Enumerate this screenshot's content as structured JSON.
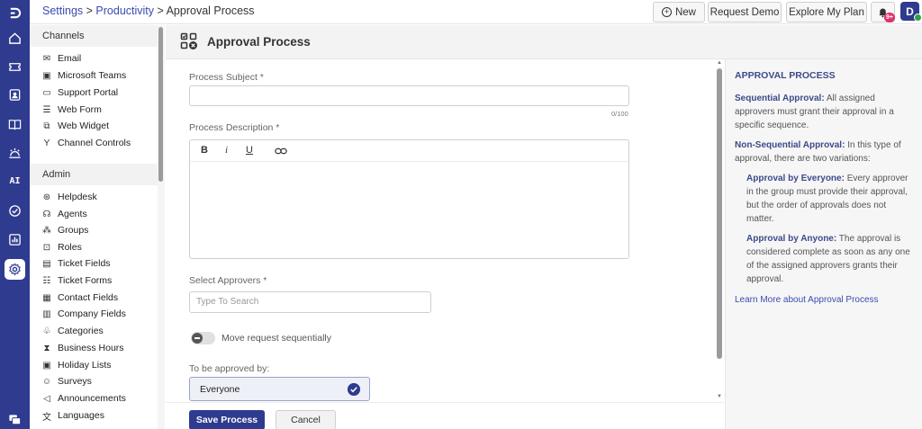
{
  "breadcrumb": {
    "settings": "Settings",
    "sep1": " > ",
    "productivity": "Productivity",
    "sep2": " > ",
    "current": "Approval Process"
  },
  "header": {
    "new_label": "New",
    "request_demo_label": "Request Demo",
    "explore_plan_label": "Explore My Plan",
    "notification_badge": "9+",
    "avatar_initial": "D"
  },
  "rail": {
    "icons": [
      "logo-icon",
      "home-icon",
      "ticket-icon",
      "contacts-icon",
      "knowledge-base-icon",
      "automation-icon",
      "ai-icon",
      "tasks-icon",
      "reports-icon",
      "settings-icon",
      "chat-icon"
    ],
    "ai_label": "AI"
  },
  "sidebar": {
    "channels_header": "Channels",
    "channels": [
      {
        "label": "Email",
        "icon": "mail-icon"
      },
      {
        "label": "Microsoft Teams",
        "icon": "teams-icon"
      },
      {
        "label": "Support Portal",
        "icon": "portal-icon"
      },
      {
        "label": "Web Form",
        "icon": "form-icon"
      },
      {
        "label": "Web Widget",
        "icon": "widget-icon"
      },
      {
        "label": "Channel Controls",
        "icon": "controls-icon"
      }
    ],
    "admin_header": "Admin",
    "admin": [
      {
        "label": "Helpdesk",
        "icon": "helpdesk-icon"
      },
      {
        "label": "Agents",
        "icon": "agents-icon"
      },
      {
        "label": "Groups",
        "icon": "groups-icon"
      },
      {
        "label": "Roles",
        "icon": "roles-icon"
      },
      {
        "label": "Ticket Fields",
        "icon": "ticket-fields-icon"
      },
      {
        "label": "Ticket Forms",
        "icon": "ticket-forms-icon"
      },
      {
        "label": "Contact Fields",
        "icon": "contact-fields-icon"
      },
      {
        "label": "Company Fields",
        "icon": "company-fields-icon"
      },
      {
        "label": "Categories",
        "icon": "categories-icon"
      },
      {
        "label": "Business Hours",
        "icon": "hourglass-icon"
      },
      {
        "label": "Holiday Lists",
        "icon": "calendar-icon"
      },
      {
        "label": "Surveys",
        "icon": "smiley-icon"
      },
      {
        "label": "Announcements",
        "icon": "megaphone-icon"
      },
      {
        "label": "Languages",
        "icon": "translate-icon"
      }
    ]
  },
  "page": {
    "title": "Approval Process"
  },
  "form": {
    "subject_label": "Process Subject *",
    "subject_value": "",
    "subject_counter": "0/100",
    "description_label": "Process Description *",
    "toolbar": {
      "bold": "B",
      "italic": "i",
      "underline": "U"
    },
    "approvers_label": "Select Approvers *",
    "approvers_placeholder": "Type To Search",
    "sequential_label": "Move request sequentially",
    "sequential_on": false,
    "approved_by_label": "To be approved by:",
    "approved_by_value": "Everyone"
  },
  "footer": {
    "save_label": "Save Process",
    "cancel_label": "Cancel"
  },
  "help": {
    "title": "APPROVAL PROCESS",
    "seq_title": "Sequential Approval:",
    "seq_text": " All assigned approvers must grant their approval in a specific sequence.",
    "nonseq_title": "Non-Sequential Approval:",
    "nonseq_text": " In this type of approval, there are two variations:",
    "everyone_title": "Approval by Everyone:",
    "everyone_text": " Every approver in the group must provide their approval, but the order of approvals does not matter.",
    "anyone_title": "Approval by Anyone:",
    "anyone_text": " The approval is considered complete as soon as any one of the assigned approvers grants their approval.",
    "link": "Learn More about Approval Process"
  },
  "colors": {
    "brand": "#2e3b8f",
    "link": "#3a4bb0",
    "badge": "#e0306a",
    "online": "#2ea14a"
  }
}
